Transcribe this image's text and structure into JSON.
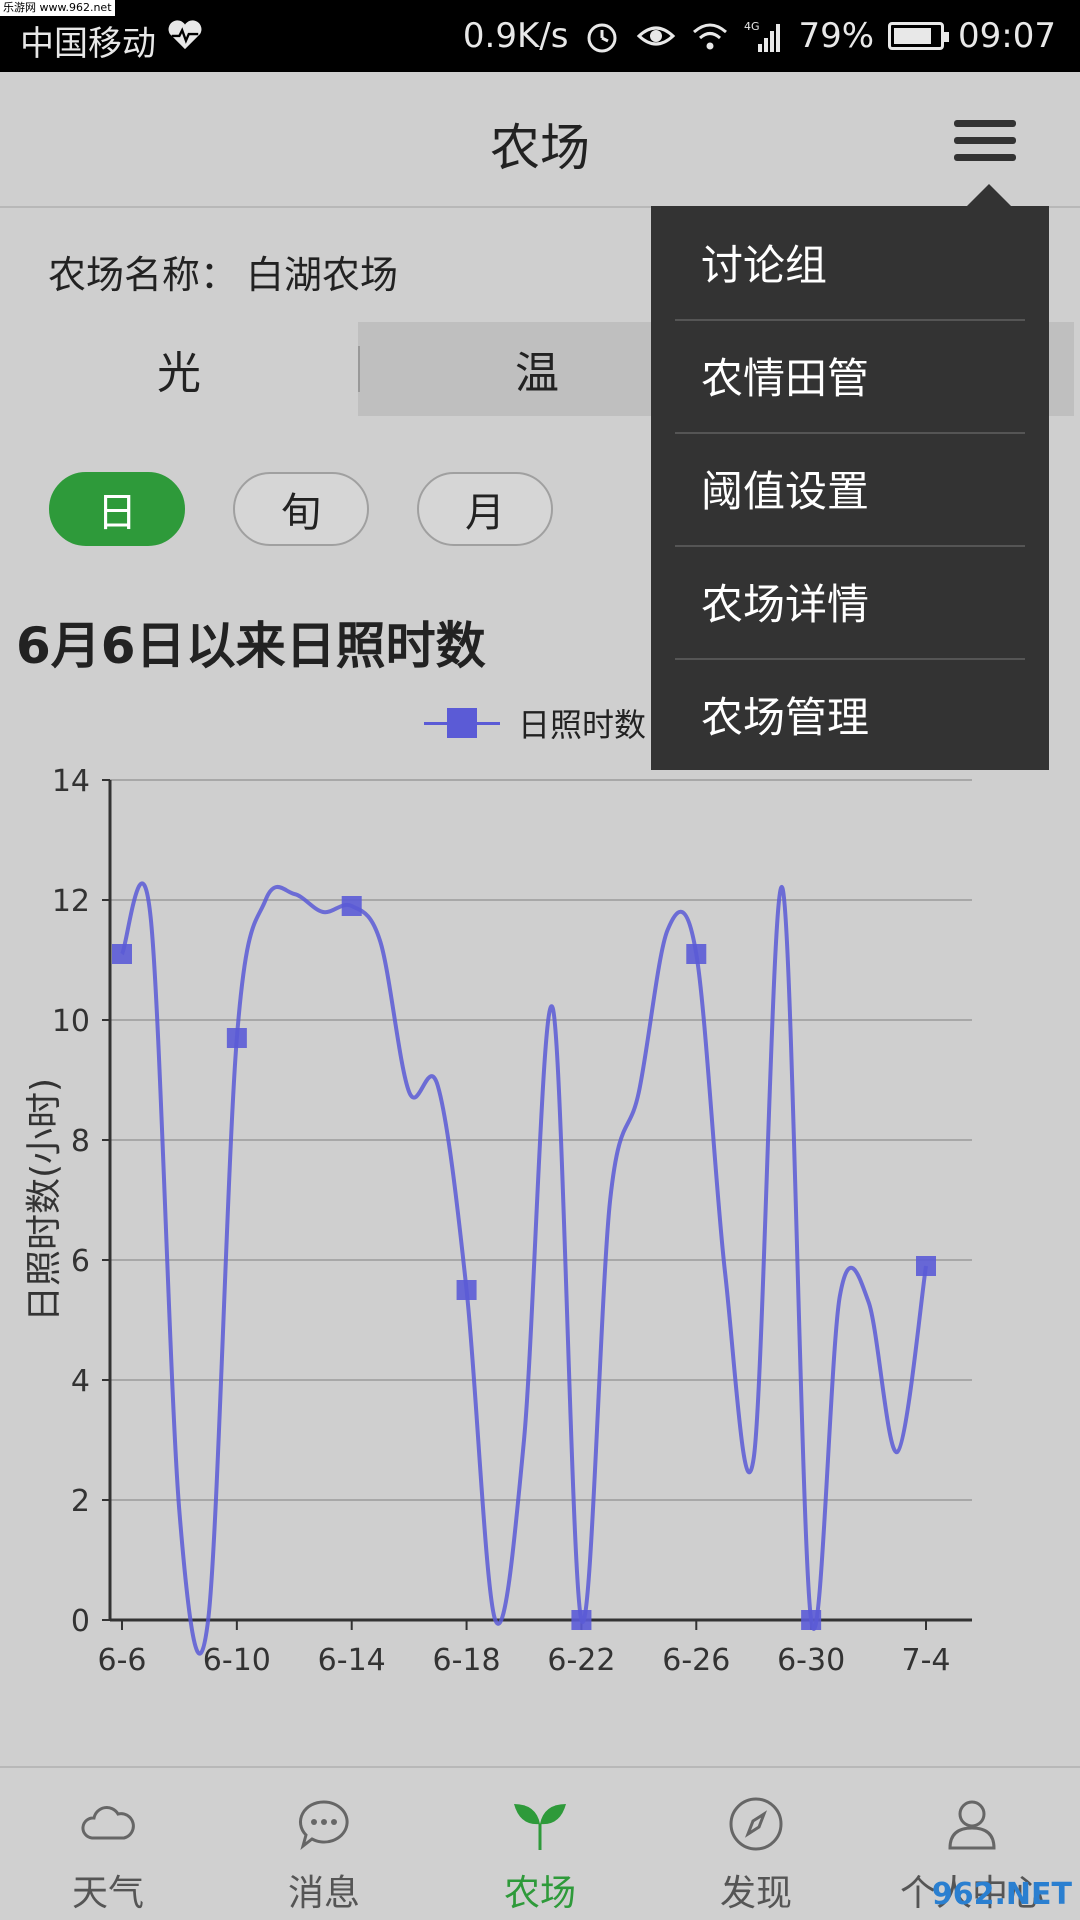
{
  "watermark": "乐游网 www.962.net",
  "status_bar": {
    "carrier": "中国移动",
    "speed": "0.9K/s",
    "network": "4G",
    "battery": "79%",
    "time": "09:07",
    "icons": [
      "heart-pulse-icon",
      "alarm-icon",
      "eye-icon",
      "wifi-icon",
      "signal-icon",
      "battery-icon"
    ]
  },
  "header": {
    "title": "农场"
  },
  "farm": {
    "label": "农场名称：",
    "value": "白湖农场"
  },
  "tabs": [
    {
      "label": "光",
      "active": true
    },
    {
      "label": "温",
      "active": false
    }
  ],
  "periods": [
    {
      "label": "日",
      "active": true
    },
    {
      "label": "旬",
      "active": false
    },
    {
      "label": "月",
      "active": false
    }
  ],
  "chart_title": "6月6日以来日照时数",
  "menu": {
    "items": [
      "讨论组",
      "农情田管",
      "阈值设置",
      "农场详情",
      "农场管理"
    ]
  },
  "chart_data": {
    "type": "line",
    "ylabel": "日照时数(小时)",
    "ylim": [
      0,
      14
    ],
    "yticks": [
      0,
      2,
      4,
      6,
      8,
      10,
      12,
      14
    ],
    "xticks": [
      "6-6",
      "6-10",
      "6-14",
      "6-18",
      "6-22",
      "6-26",
      "6-30",
      "7-4"
    ],
    "series": [
      {
        "name": "日照时数",
        "color": "#5b5bd6",
        "x": [
          "6-6",
          "6-7",
          "6-8",
          "6-9",
          "6-10",
          "6-11",
          "6-12",
          "6-13",
          "6-14",
          "6-15",
          "6-16",
          "6-17",
          "6-18",
          "6-19",
          "6-20",
          "6-21",
          "6-22",
          "6-23",
          "6-24",
          "6-25",
          "6-26",
          "6-27",
          "6-28",
          "6-29",
          "6-30",
          "7-1",
          "7-2",
          "7-3",
          "7-4"
        ],
        "values": [
          11.1,
          11.7,
          1.8,
          0.0,
          9.7,
          12.0,
          12.1,
          11.8,
          11.9,
          11.3,
          8.8,
          8.9,
          5.5,
          0.0,
          3.0,
          10.2,
          0.0,
          7.0,
          8.8,
          11.5,
          11.1,
          5.8,
          2.7,
          12.2,
          0.0,
          5.4,
          5.3,
          2.8,
          5.9
        ],
        "markers": [
          0,
          4,
          8,
          12,
          16,
          20,
          24,
          28
        ]
      }
    ]
  },
  "bottom_nav": [
    {
      "label": "天气",
      "icon": "cloud-icon",
      "active": false
    },
    {
      "label": "消息",
      "icon": "chat-icon",
      "active": false
    },
    {
      "label": "农场",
      "icon": "sprout-icon",
      "active": true
    },
    {
      "label": "发现",
      "icon": "compass-icon",
      "active": false
    },
    {
      "label": "个人中心",
      "icon": "user-icon",
      "active": false
    }
  ],
  "corner_mark": "962.NET"
}
